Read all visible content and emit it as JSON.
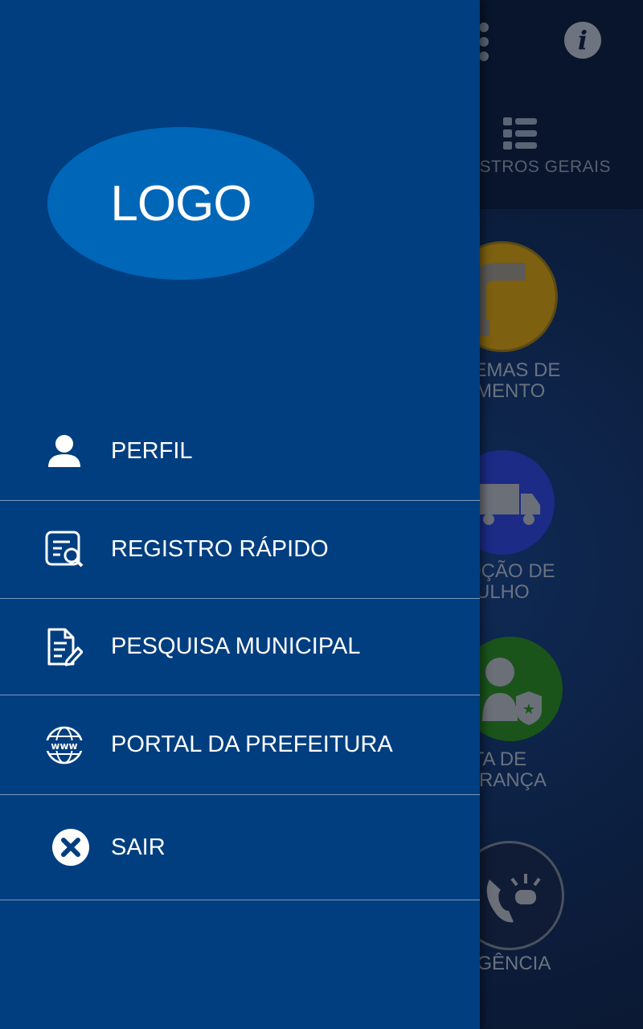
{
  "background_screen": {
    "registros_label": "STROS GERAIS",
    "tiles": [
      {
        "label": "BLEMAS DE\nEAMENTO",
        "color": "#8a6a12"
      },
      {
        "label": "MOÇÃO DE\nNTULHO",
        "color": "#1d2f8a"
      },
      {
        "label": "ALTA DE\nGURANÇA",
        "color": "#1c5a1c"
      },
      {
        "label": "ERGÊNCIA",
        "color": "#13203a"
      }
    ]
  },
  "drawer": {
    "logo_text": "LOGO",
    "menu": [
      {
        "label": "PERFIL",
        "icon": "person-icon"
      },
      {
        "label": "REGISTRO RÁPIDO",
        "icon": "document-search-icon"
      },
      {
        "label": "PESQUISA MUNICIPAL",
        "icon": "document-edit-icon"
      },
      {
        "label": "PORTAL DA PREFEITURA",
        "icon": "globe-www-icon"
      },
      {
        "label": "SAIR",
        "icon": "close-circle-icon"
      }
    ]
  },
  "colors": {
    "drawer_bg": "#003e80",
    "logo_bg": "#0066b8",
    "divider": "#7d99bd",
    "text": "#ffffff"
  }
}
